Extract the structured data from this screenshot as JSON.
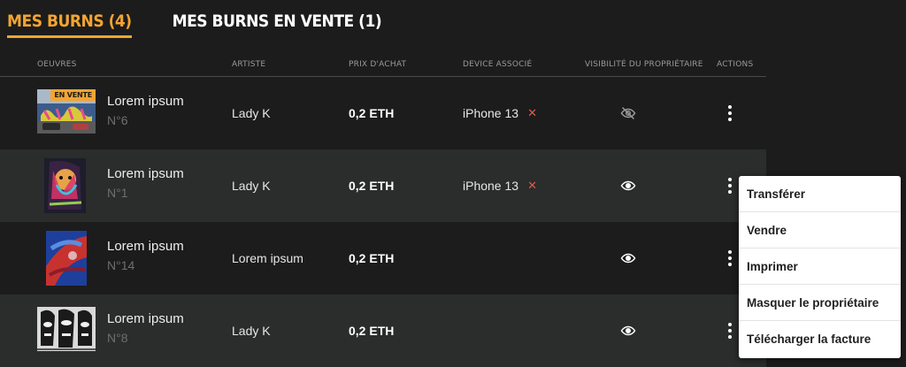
{
  "tabs": [
    {
      "label": "MES BURNS (4)",
      "active": true
    },
    {
      "label": "MES BURNS EN VENTE (1)",
      "active": false
    }
  ],
  "table": {
    "headers": {
      "work": "Oeuvres",
      "artist": "Artiste",
      "price": "Prix d'achat",
      "device": "Device associé",
      "visibility": "Visibilité du propriétaire",
      "actions": "Actions"
    },
    "rows": [
      {
        "name": "Lorem ipsum",
        "number": "N°6",
        "badge": "EN VENTE",
        "artist": "Lady K",
        "price": "0,2 ETH",
        "device": "iPhone 13",
        "visibility": "hidden",
        "thumb_icon": "graffiti-wall-image"
      },
      {
        "name": "Lorem ipsum",
        "number": "N°1",
        "badge": "",
        "artist": "Lady K",
        "price": "0,2 ETH",
        "device": "iPhone 13",
        "visibility": "visible",
        "thumb_icon": "colorful-portrait-image"
      },
      {
        "name": "Lorem ipsum",
        "number": "N°14",
        "badge": "",
        "artist": "Lorem ipsum",
        "price": "0,2 ETH",
        "device": "",
        "visibility": "visible",
        "thumb_icon": "blue-red-abstract-image"
      },
      {
        "name": "Lorem ipsum",
        "number": "N°8",
        "badge": "",
        "artist": "Lady K",
        "price": "0,2 ETH",
        "device": "",
        "visibility": "visible",
        "thumb_icon": "black-white-faces-image"
      }
    ]
  },
  "context_menu": {
    "items": [
      "Transférer",
      "Vendre",
      "Imprimer",
      "Masquer le propriétaire",
      "Télécharger la facture"
    ]
  },
  "colors": {
    "accent": "#f2a531",
    "background": "#1c1c1c",
    "row_alt": "#2b2c2c",
    "remove": "#e05a4c"
  }
}
